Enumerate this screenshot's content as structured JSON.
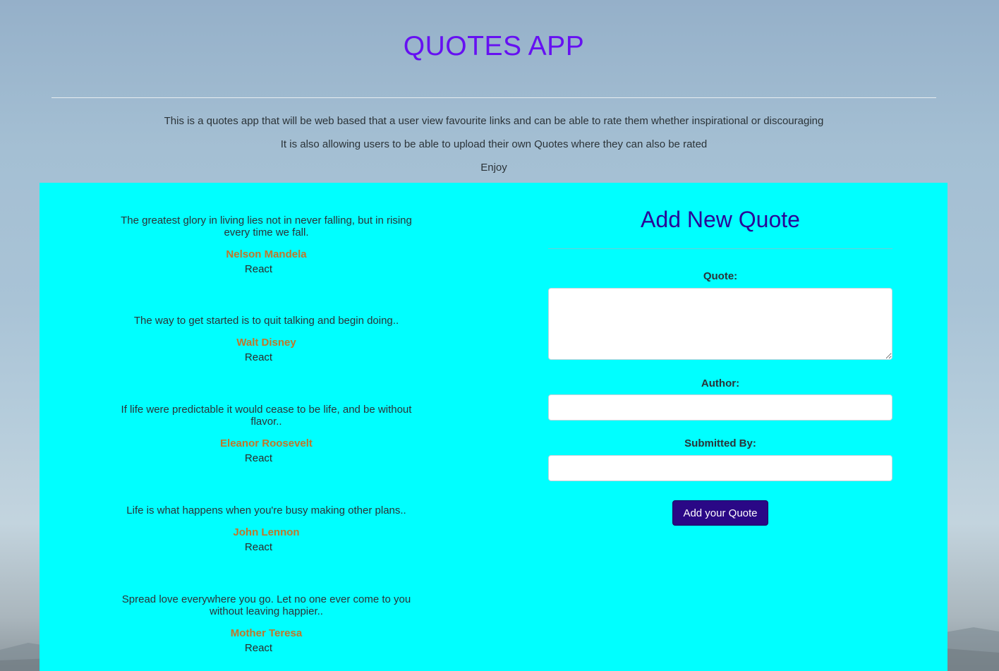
{
  "header": {
    "title": "QUOTES APP",
    "intro_lines": [
      "This is a quotes app that will be web based that a user view favourite links and can be able to rate them whether inspirational or discouraging",
      "It is also allowing users to be able to upload their own Quotes where they can also be rated",
      "Enjoy"
    ]
  },
  "quotes": [
    {
      "text": "The greatest glory in living lies not in never falling, but in rising every time we fall.",
      "author": "Nelson Mandela",
      "action": "React"
    },
    {
      "text": "The way to get started is to quit talking and begin doing..",
      "author": "Walt Disney",
      "action": "React"
    },
    {
      "text": "If life were predictable it would cease to be life, and be without flavor..",
      "author": "Eleanor Roosevelt",
      "action": "React"
    },
    {
      "text": "Life is what happens when you're busy making other plans..",
      "author": "John Lennon",
      "action": "React"
    },
    {
      "text": "Spread love everywhere you go. Let no one ever come to you without leaving happier..",
      "author": "Mother Teresa",
      "action": "React"
    }
  ],
  "form": {
    "title": "Add New Quote",
    "quote_label": "Quote:",
    "quote_value": "",
    "author_label": "Author:",
    "author_value": "",
    "submitted_by_label": "Submitted By:",
    "submitted_by_value": "",
    "submit_label": "Add your Quote"
  },
  "colors": {
    "title": "#6610f2",
    "panel_background": "#00ffff",
    "author_text": "#c0762a",
    "form_title": "#2a0597",
    "button_background": "#2a0886"
  }
}
